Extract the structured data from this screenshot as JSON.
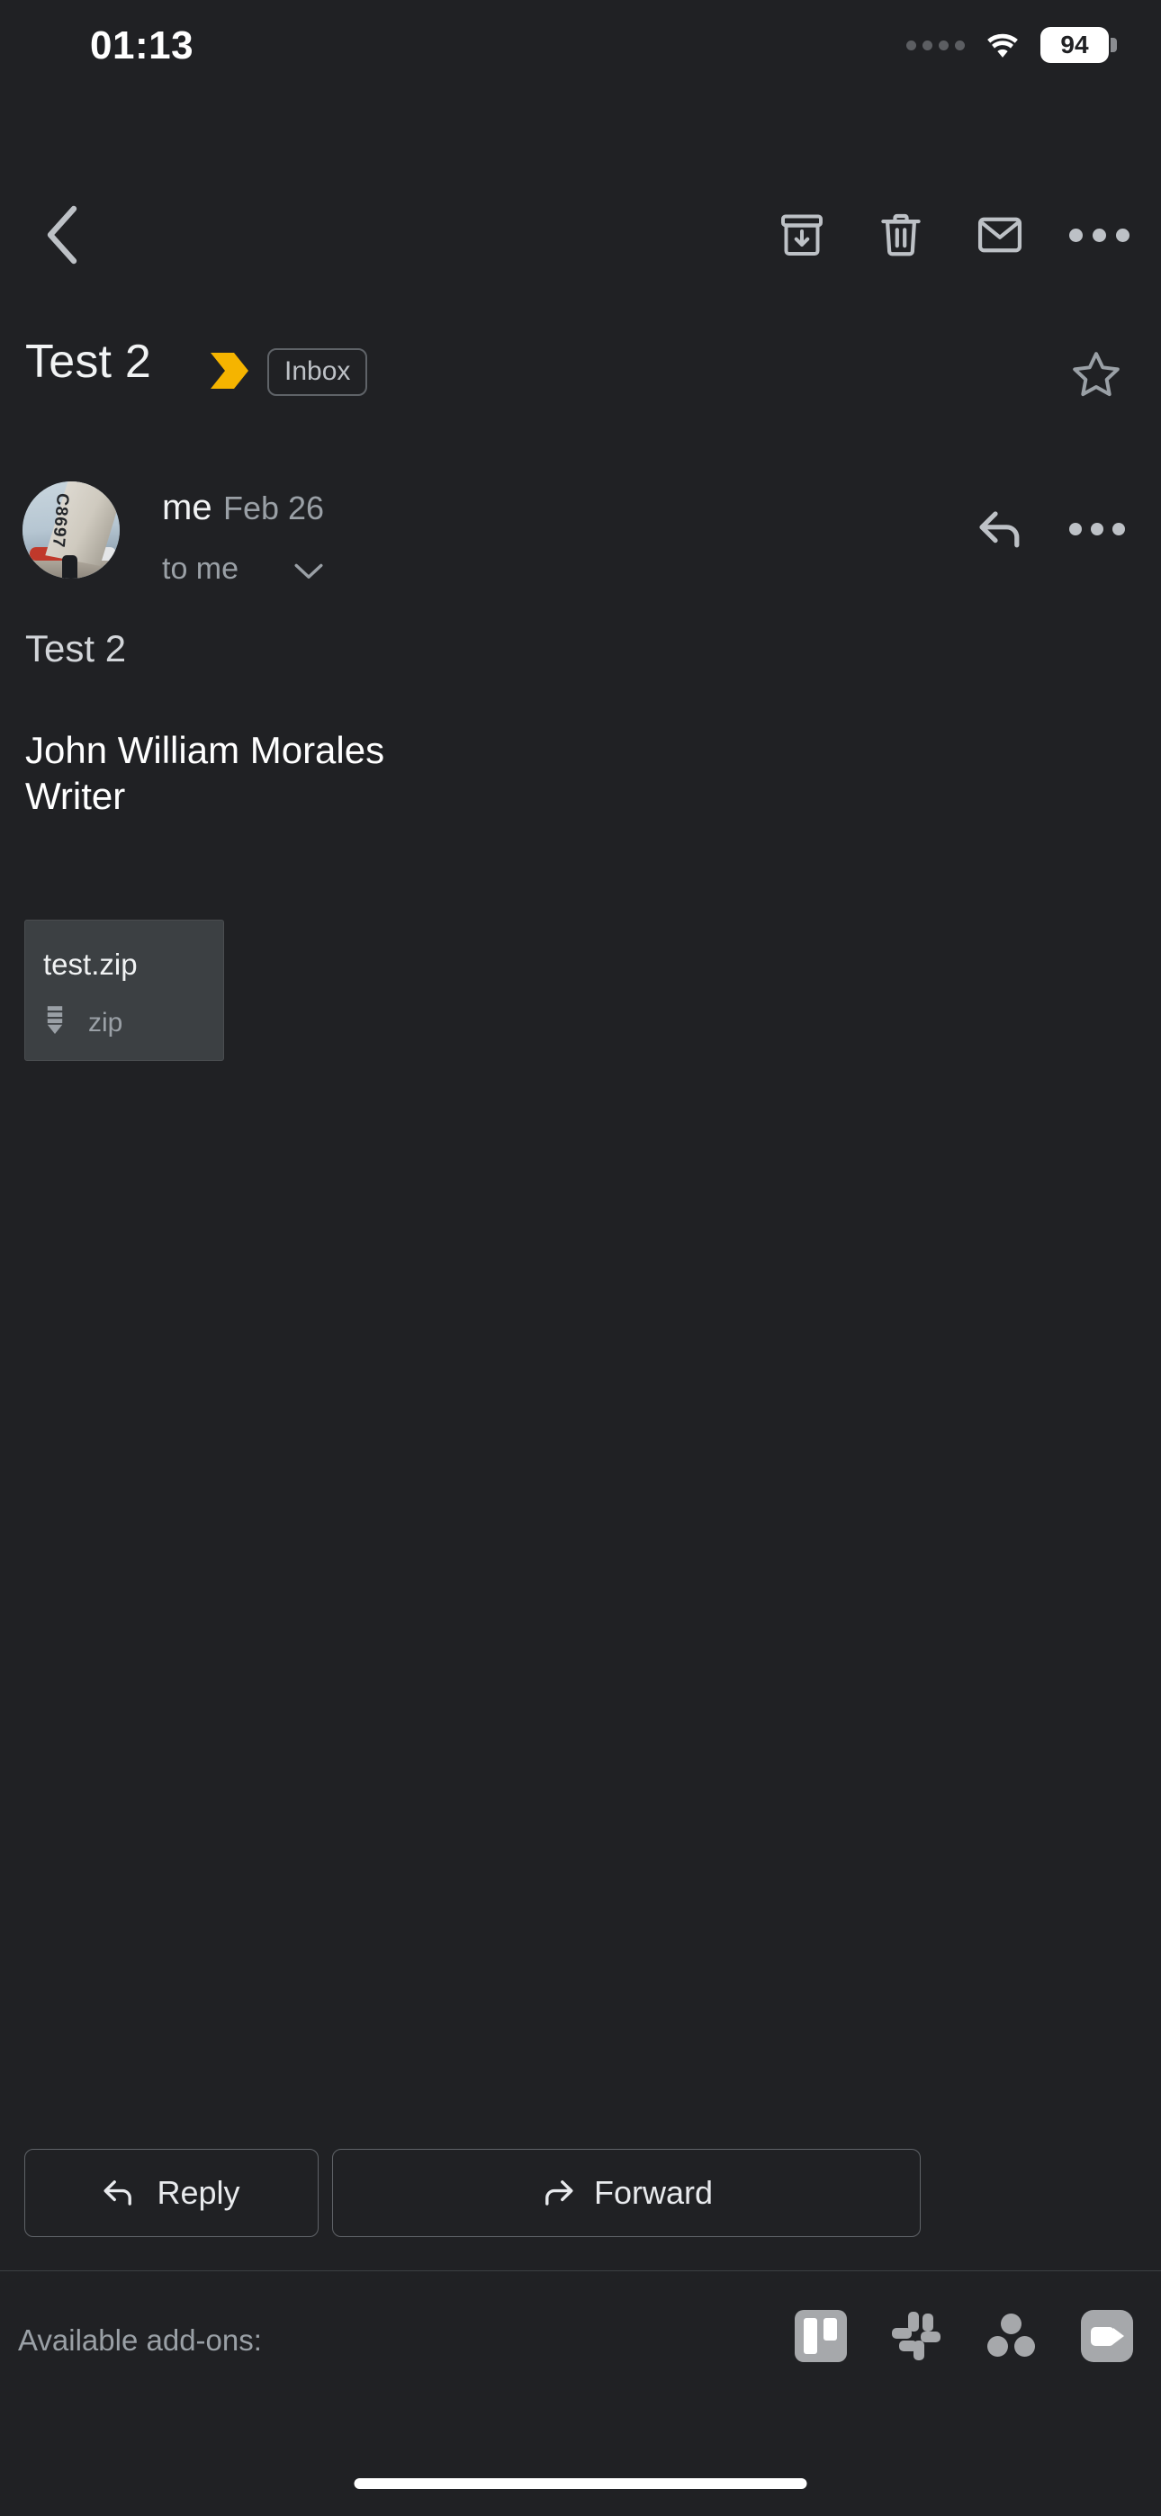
{
  "status_bar": {
    "time": "01:13",
    "signal_icon": "signal-dots-icon",
    "wifi_icon": "wifi-icon",
    "battery_level": "94",
    "battery_icon": "battery-icon"
  },
  "action_bar": {
    "back_icon": "back-chevron-icon",
    "archive_icon": "archive-icon",
    "delete_icon": "trash-icon",
    "mark_unread_icon": "envelope-icon",
    "more_icon": "more-options-icon"
  },
  "subject": {
    "title": "Test 2",
    "important_marker_icon": "important-chevron-icon",
    "important_marker_color": "#f5b400",
    "label": "Inbox",
    "star_icon": "star-outline-icon",
    "starred": false
  },
  "message": {
    "sender": "me",
    "date": "Feb 26",
    "recipient": "to me",
    "recipient_expand_icon": "chevron-down-icon",
    "avatar_icon": "avatar-photo",
    "avatar_registration": "C8697",
    "reply_icon": "reply-arrow-icon",
    "more_icon": "more-options-icon",
    "body_lines": [
      "Test 2",
      "John William Morales",
      "Writer"
    ]
  },
  "attachment": {
    "filename": "test.zip",
    "type_label": "zip",
    "type_icon": "zip-file-icon"
  },
  "footer_actions": {
    "reply_label": "Reply",
    "reply_icon": "reply-arrow-icon",
    "forward_label": "Forward",
    "forward_icon": "forward-arrow-icon"
  },
  "addons": {
    "label": "Available add-ons:",
    "items": [
      {
        "name": "trello-addon-icon"
      },
      {
        "name": "slack-addon-icon"
      },
      {
        "name": "asana-addon-icon"
      },
      {
        "name": "zoom-addon-icon"
      }
    ]
  },
  "system": {
    "home_indicator": "home-indicator"
  },
  "colors": {
    "background": "#202124",
    "surface": "#3c4043",
    "text_primary": "#f1f3f4",
    "text_secondary": "#9aa0a6",
    "accent_important": "#f5b400",
    "divider": "#3c4043"
  }
}
